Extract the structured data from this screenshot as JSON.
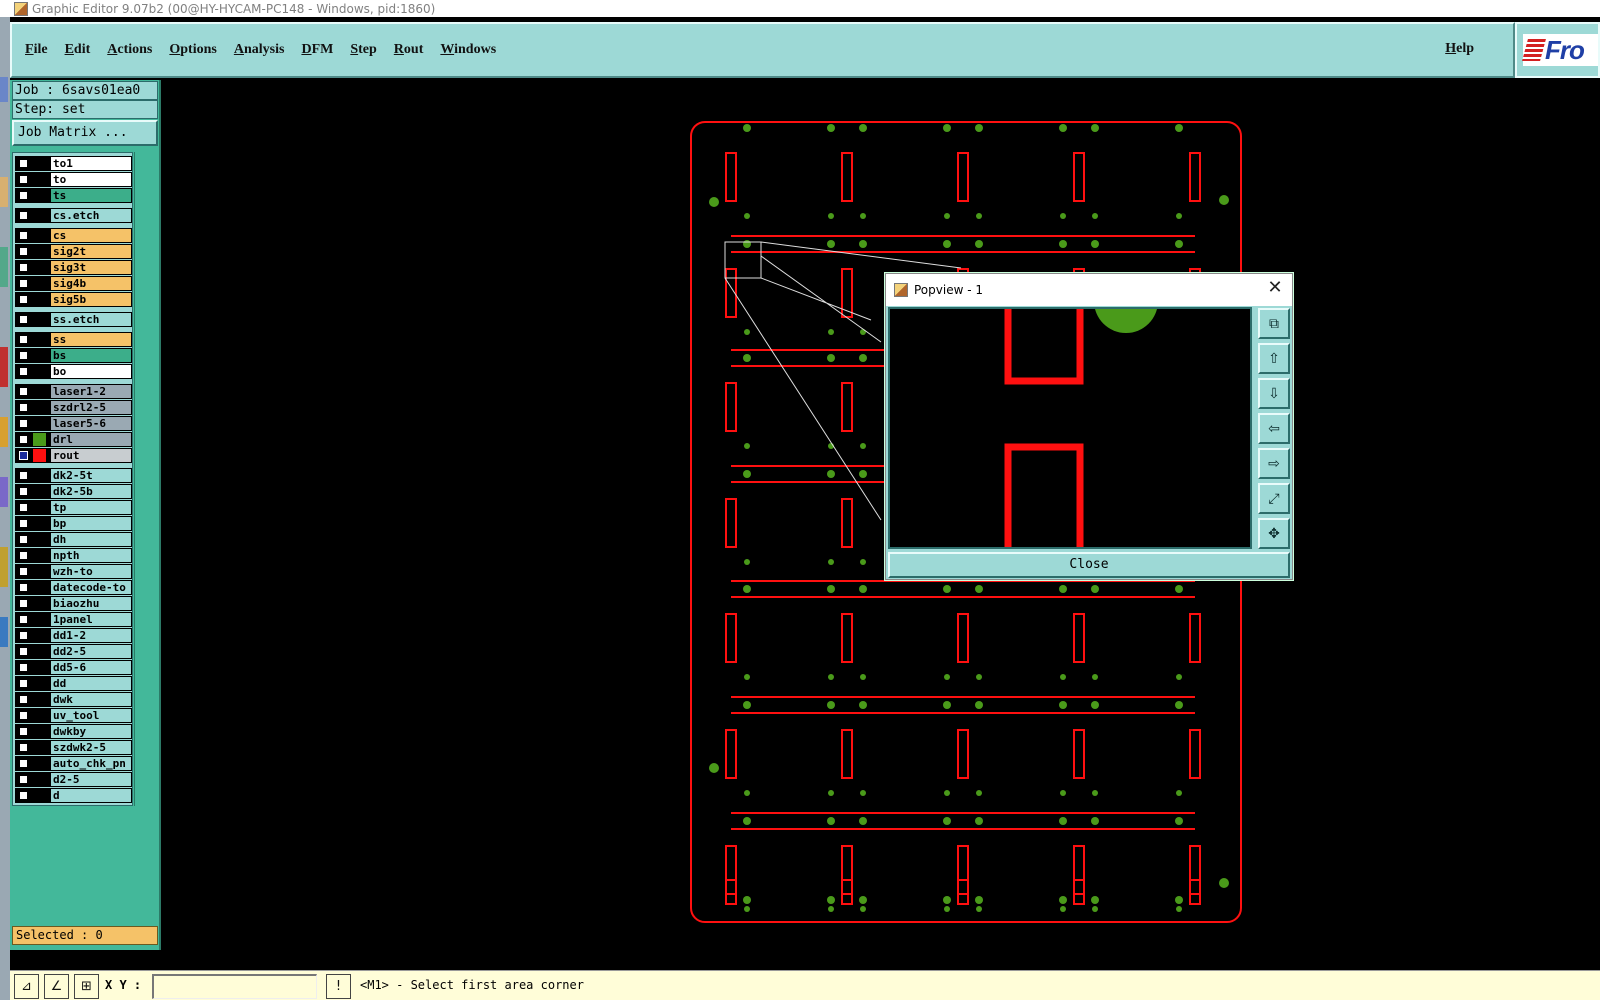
{
  "window": {
    "title": "Graphic Editor 9.07b2 (00@HY-HYCAM-PC148 - Windows, pid:1860)"
  },
  "menu": {
    "items": [
      "File",
      "Edit",
      "Actions",
      "Options",
      "Analysis",
      "DFM",
      "Step",
      "Rout",
      "Windows"
    ],
    "help": "Help",
    "logo_text": "Fro"
  },
  "left_panel": {
    "job": "Job : 6savs01ea0",
    "step": "Step: set",
    "job_matrix": "Job Matrix ...",
    "selected": "Selected : 0",
    "layers": [
      {
        "name": "to1",
        "bg": "white"
      },
      {
        "name": "to",
        "bg": "white"
      },
      {
        "name": "ts",
        "bg": "green"
      },
      {
        "name": "cs.etch",
        "bg": "cyan"
      },
      {
        "name": "cs",
        "bg": "orange"
      },
      {
        "name": "sig2t",
        "bg": "orange"
      },
      {
        "name": "sig3t",
        "bg": "orange"
      },
      {
        "name": "sig4b",
        "bg": "orange"
      },
      {
        "name": "sig5b",
        "bg": "orange"
      },
      {
        "name": "ss.etch",
        "bg": "cyan"
      },
      {
        "name": "ss",
        "bg": "orange"
      },
      {
        "name": "bs",
        "bg": "green"
      },
      {
        "name": "bo",
        "bg": "white"
      },
      {
        "name": "laser1-2",
        "bg": "gray"
      },
      {
        "name": "szdrl2-5",
        "bg": "gray"
      },
      {
        "name": "laser5-6",
        "bg": "gray"
      },
      {
        "name": "drl",
        "bg": "gray",
        "swatch": "#4a9a1a"
      },
      {
        "name": "rout",
        "bg": "active",
        "swatch": "#ff1010",
        "selected": true
      },
      {
        "name": "dk2-5t",
        "bg": "cyan"
      },
      {
        "name": "dk2-5b",
        "bg": "cyan"
      },
      {
        "name": "tp",
        "bg": "cyan"
      },
      {
        "name": "bp",
        "bg": "cyan"
      },
      {
        "name": "dh",
        "bg": "cyan"
      },
      {
        "name": "npth",
        "bg": "cyan"
      },
      {
        "name": "wzh-to",
        "bg": "cyan"
      },
      {
        "name": "datecode-to",
        "bg": "cyan"
      },
      {
        "name": "biaozhu",
        "bg": "cyan"
      },
      {
        "name": "1panel",
        "bg": "cyan"
      },
      {
        "name": "dd1-2",
        "bg": "cyan"
      },
      {
        "name": "dd2-5",
        "bg": "cyan"
      },
      {
        "name": "dd5-6",
        "bg": "cyan"
      },
      {
        "name": "dd",
        "bg": "cyan"
      },
      {
        "name": "dwk",
        "bg": "cyan"
      },
      {
        "name": "uv_tool",
        "bg": "cyan"
      },
      {
        "name": "dwkby",
        "bg": "cyan"
      },
      {
        "name": "szdwk2-5",
        "bg": "cyan"
      },
      {
        "name": "auto_chk_pn",
        "bg": "cyan"
      },
      {
        "name": "d2-5",
        "bg": "cyan"
      },
      {
        "name": "d",
        "bg": "cyan"
      }
    ]
  },
  "popview": {
    "title": "Popview - 1",
    "close_label": "Close",
    "tools": [
      "zoom-window-icon",
      "pan-up-icon",
      "pan-down-icon",
      "pan-left-icon",
      "pan-right-icon",
      "zoom-fit-icon",
      "zoom-home-icon"
    ]
  },
  "status": {
    "xy_label": "X Y :",
    "xy_value": "",
    "message": "<M1> - Select first area corner"
  },
  "colors": {
    "rout": "#ff1010",
    "drill": "#4a9a1a",
    "panel_bg": "#9dd9d6",
    "panel_dark": "#43b89a"
  }
}
